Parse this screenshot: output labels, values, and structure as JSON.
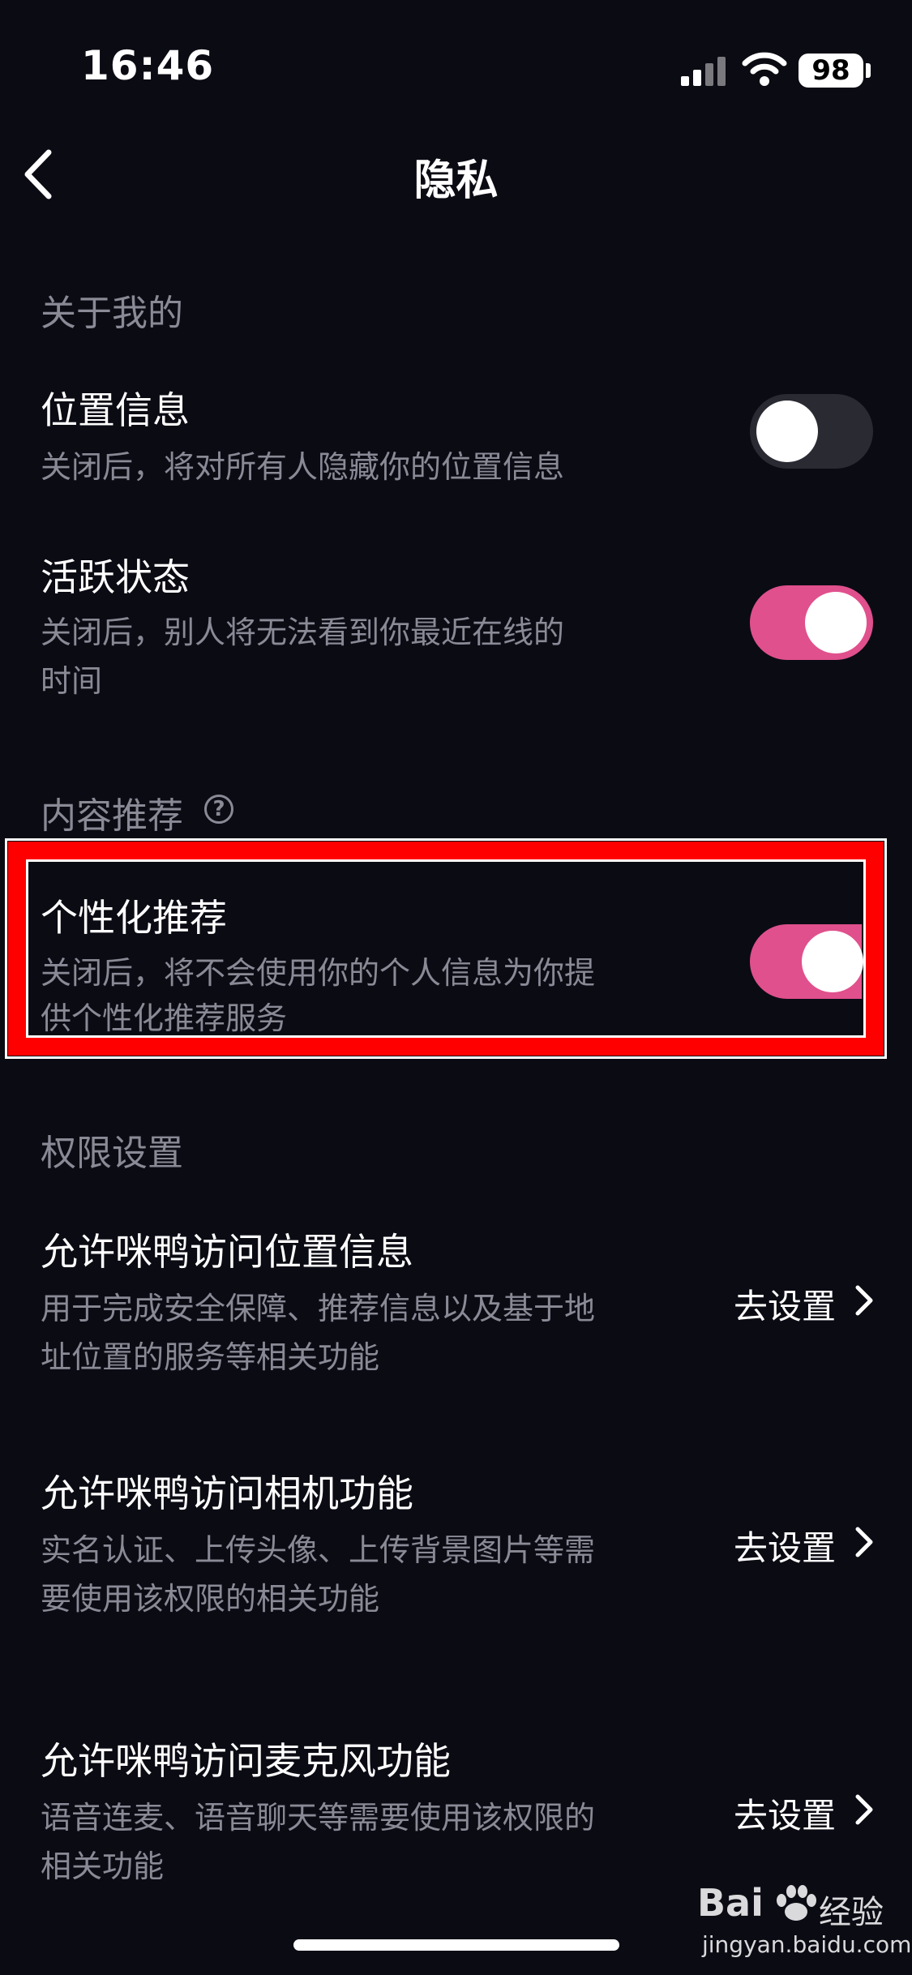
{
  "status_bar": {
    "time": "16:46",
    "battery": "98"
  },
  "header": {
    "title": "隐私"
  },
  "sections": {
    "about_me": {
      "title": "关于我的"
    },
    "content_recommend": {
      "title": "内容推荐"
    },
    "permissions": {
      "title": "权限设置"
    }
  },
  "items": {
    "location": {
      "title": "位置信息",
      "description": "关闭后，将对所有人隐藏你的位置信息",
      "enabled": false
    },
    "active_status": {
      "title": "活跃状态",
      "description_line1": "关闭后，别人将无法看到你最近在线的",
      "description_line2": "时间",
      "enabled": true
    },
    "personalized": {
      "title": "个性化推荐",
      "description_line1": "关闭后，将不会使用你的个人信息为你提",
      "description_line2": "供个性化推荐服务",
      "enabled": true
    },
    "perm_location": {
      "title": "允许咪鸭访问位置信息",
      "description_line1": "用于完成安全保障、推荐信息以及基于地",
      "description_line2": "址位置的服务等相关功能",
      "action": "去设置"
    },
    "perm_camera": {
      "title": "允许咪鸭访问相机功能",
      "description_line1": "实名认证、上传头像、上传背景图片等需",
      "description_line2": "要使用该权限的相关功能",
      "action": "去设置"
    },
    "perm_mic": {
      "title": "允许咪鸭访问麦克风功能",
      "description_line1": "语音连麦、语音聊天等需要使用该权限的",
      "description_line2": "相关功能",
      "action": "去设置"
    }
  },
  "watermark": {
    "brand": "Bai",
    "sub": "经验",
    "url": "jingyan.baidu.com"
  },
  "colors": {
    "background": "#0b0b14",
    "toggle_on": "#e0508c",
    "toggle_off": "#2a2a33",
    "secondary_text": "#8a8a96",
    "highlight": "#ff0000"
  }
}
